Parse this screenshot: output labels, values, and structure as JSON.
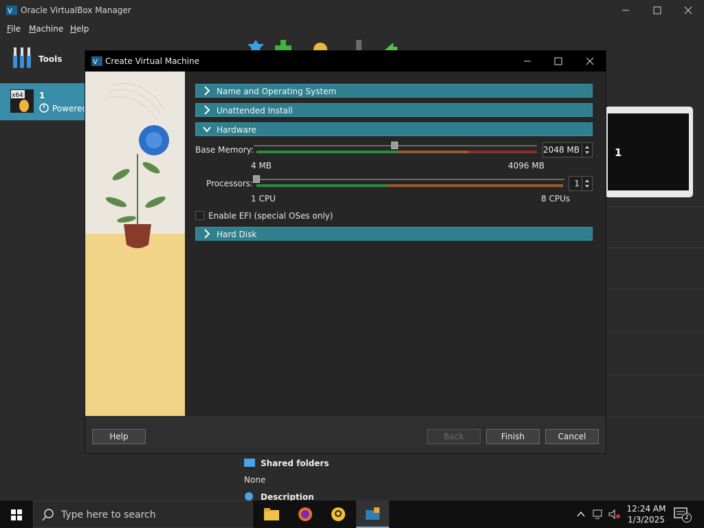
{
  "main_window": {
    "title": "Oracle VirtualBox Manager",
    "menu": [
      "File",
      "Machine",
      "Help"
    ],
    "tools_label": "Tools",
    "vm": {
      "badge": "x64",
      "name": "1",
      "state": "Powered"
    },
    "preview_label": "1",
    "details": {
      "shared_folders_title": "Shared folders",
      "shared_folders_value": "None",
      "description_title": "Description"
    }
  },
  "dialog": {
    "title": "Create Virtual Machine",
    "sections": {
      "name_os": "Name and Operating System",
      "unattended": "Unattended Install",
      "hardware": "Hardware",
      "hard_disk": "Hard Disk"
    },
    "memory": {
      "label": "Base Memory:",
      "value": "2048 MB",
      "min": "4 MB",
      "max": "4096 MB",
      "level": 0.5
    },
    "processors": {
      "label": "Processors:",
      "value": "1",
      "min": "1 CPU",
      "max": "8 CPUs",
      "level": 0.0
    },
    "efi_label": "Enable EFI (special OSes only)",
    "buttons": {
      "help": "Help",
      "back": "Back",
      "finish": "Finish",
      "cancel": "Cancel"
    }
  },
  "taskbar": {
    "search_placeholder": "Type here to search",
    "time": "12:24 AM",
    "date": "1/3/2025",
    "notifications": "2"
  },
  "colors": {
    "accent": "#3a8da8",
    "section": "#2f7f8f",
    "green": "#2e8b3e",
    "orange": "#9a5a2a",
    "red": "#8a2e2e"
  }
}
